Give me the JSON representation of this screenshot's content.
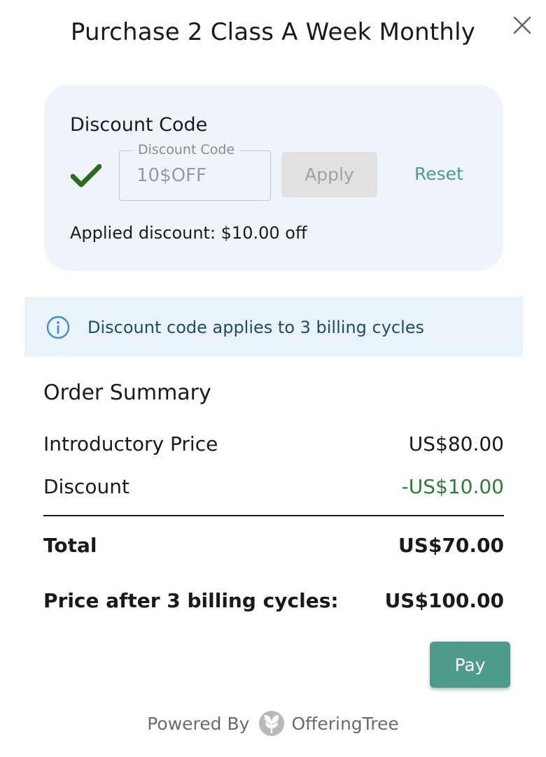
{
  "dialog": {
    "title": "Purchase 2 Class A Week Monthly",
    "close_icon": "close-icon"
  },
  "discount": {
    "heading": "Discount Code",
    "status_icon": "checkmark-icon",
    "field_label": "Discount Code",
    "field_value": "10$OFF",
    "apply_label": "Apply",
    "reset_label": "Reset",
    "applied_text": "Applied discount: $10.00 off"
  },
  "notice": {
    "icon": "info-icon",
    "text": "Discount code applies to 3 billing cycles"
  },
  "order_summary": {
    "title": "Order Summary",
    "rows": [
      {
        "label": "Introductory Price",
        "value": "US$80.00"
      },
      {
        "label": "Discount",
        "value": "-US$10.00"
      },
      {
        "label": "Total",
        "value": "US$70.00"
      },
      {
        "label": "Price after 3 billing cycles:",
        "value": "US$100.00"
      }
    ]
  },
  "actions": {
    "pay_label": "Pay"
  },
  "footer": {
    "powered_by": "Powered By",
    "brand": "OfferingTree",
    "logo_icon": "offeringtree-logo-icon"
  },
  "colors": {
    "accent": "#4e9b8b",
    "discount_green": "#2e7d32",
    "check_green": "#2e6b1f",
    "card_bg": "#eff4fb",
    "info_bg": "#e8f3fa",
    "info_text": "#1e4d6b"
  }
}
